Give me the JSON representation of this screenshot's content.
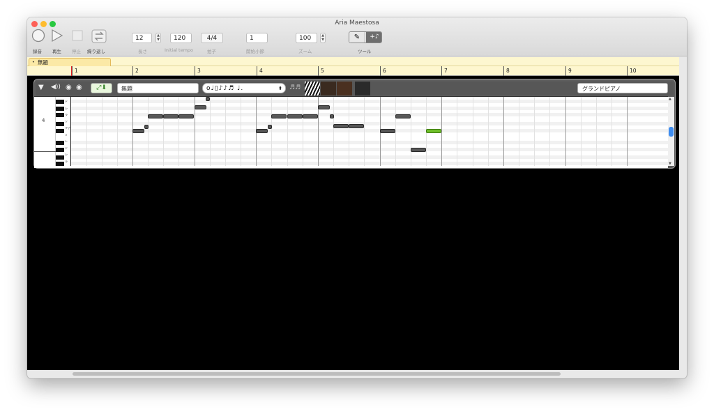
{
  "window": {
    "title": "Aria Maestosa",
    "traffic_colors": [
      "#fd5f57",
      "#febc2e",
      "#28c840"
    ]
  },
  "toolbar": {
    "record_label": "録音",
    "play_label": "再生",
    "stop_label": "停止",
    "loop_label": "繰り返し",
    "length_label": "長さ",
    "length_value": "12",
    "tempo_label": "Initial tempo",
    "tempo_value": "120",
    "time_sig_label": "拍子",
    "time_sig_value": "4/4",
    "start_measure_label": "開始小節",
    "start_measure_value": "1",
    "zoom_label": "ズーム",
    "zoom_value": "100",
    "tools_label": "ツール"
  },
  "sequence_tab": {
    "label": "無題"
  },
  "ruler": {
    "measures": [
      "1",
      "2",
      "3",
      "4",
      "5",
      "6",
      "7",
      "8",
      "9",
      "10"
    ]
  },
  "track": {
    "name": "無題",
    "instrument": "グランドピアノ",
    "octave_label": "4",
    "accent_color": "#6fbf2a",
    "key_labels": [
      "ド",
      "シ",
      "ラ",
      "ソ",
      "ファ",
      "ミ",
      "レ",
      "ド",
      "シ",
      "ラ"
    ],
    "durations_glyphs": "o♩▯♪♪♬ ♩."
  }
}
